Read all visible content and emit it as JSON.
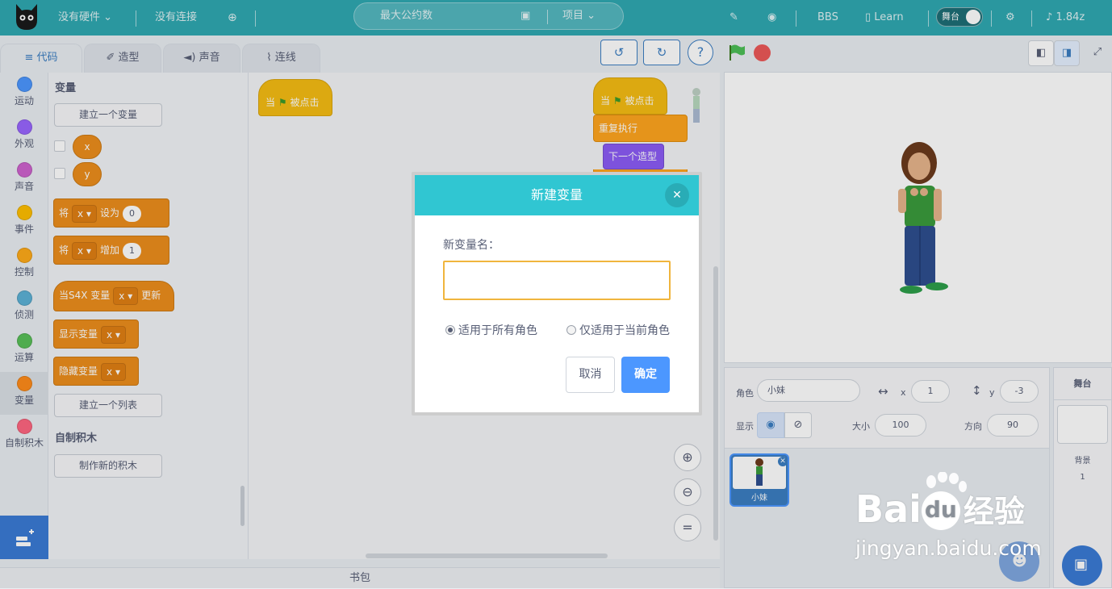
{
  "topbar": {
    "hardware": "没有硬件",
    "connection": "没有连接",
    "project_title": "最大公约数",
    "project_menu": "项目",
    "bbs": "BBS",
    "learn": "Learn",
    "stage_toggle": "舞台",
    "version": "1.84z"
  },
  "tabs": [
    {
      "label": "代码"
    },
    {
      "label": "造型"
    },
    {
      "label": "声音"
    },
    {
      "label": "连线"
    }
  ],
  "categories": [
    {
      "label": "运动",
      "color": "#4c97ff"
    },
    {
      "label": "外观",
      "color": "#9966ff"
    },
    {
      "label": "声音",
      "color": "#cf63cf"
    },
    {
      "label": "事件",
      "color": "#ffbf00"
    },
    {
      "label": "控制",
      "color": "#ffab19"
    },
    {
      "label": "侦测",
      "color": "#5cb1d6"
    },
    {
      "label": "运算",
      "color": "#59c059"
    },
    {
      "label": "变量",
      "color": "#ff8c1a"
    },
    {
      "label": "自制积木",
      "color": "#ff6680"
    }
  ],
  "palette": {
    "section_variables": "变量",
    "make_variable": "建立一个变量",
    "var_x": "x",
    "var_y": "y",
    "set_block": {
      "prefix": "将",
      "var": "x",
      "mid": "设为",
      "value": "0"
    },
    "change_block": {
      "prefix": "将",
      "var": "x",
      "mid": "增加",
      "value": "1"
    },
    "when_var_block": {
      "prefix": "当S4X 变量",
      "var": "x",
      "suffix": "更新"
    },
    "show_block": {
      "label": "显示变量",
      "var": "x"
    },
    "hide_block": {
      "label": "隐藏变量",
      "var": "x"
    },
    "make_list": "建立一个列表",
    "section_custom": "自制积木",
    "make_block": "制作新的积木"
  },
  "workspace": {
    "hat1": {
      "when": "当",
      "clicked": "被点击"
    },
    "hat2": {
      "when": "当",
      "clicked": "被点击"
    },
    "forever": "重复执行",
    "next_costume": "下一个造型"
  },
  "bag": "书包",
  "sprite": {
    "label_role": "角色",
    "name": "小妹",
    "x_label": "x",
    "x": "1",
    "y_label": "y",
    "y": "-3",
    "show_label": "显示",
    "size_label": "大小",
    "size": "100",
    "direction_label": "方向",
    "direction": "90",
    "thumb_name": "小妹"
  },
  "stage_col": {
    "title": "舞台",
    "backdrops_label": "背景",
    "backdrops_count": "1"
  },
  "dialog": {
    "title": "新建变量",
    "name_label": "新变量名：",
    "input_value": "",
    "option_all": "适用于所有角色",
    "option_current": "仅适用于当前角色",
    "selected_option": "all",
    "cancel": "取消",
    "ok": "确定"
  },
  "watermark": {
    "brand": "Bai",
    "brand_du": "du",
    "brand_cn": "经验",
    "url": "jingyan.baidu.com"
  }
}
